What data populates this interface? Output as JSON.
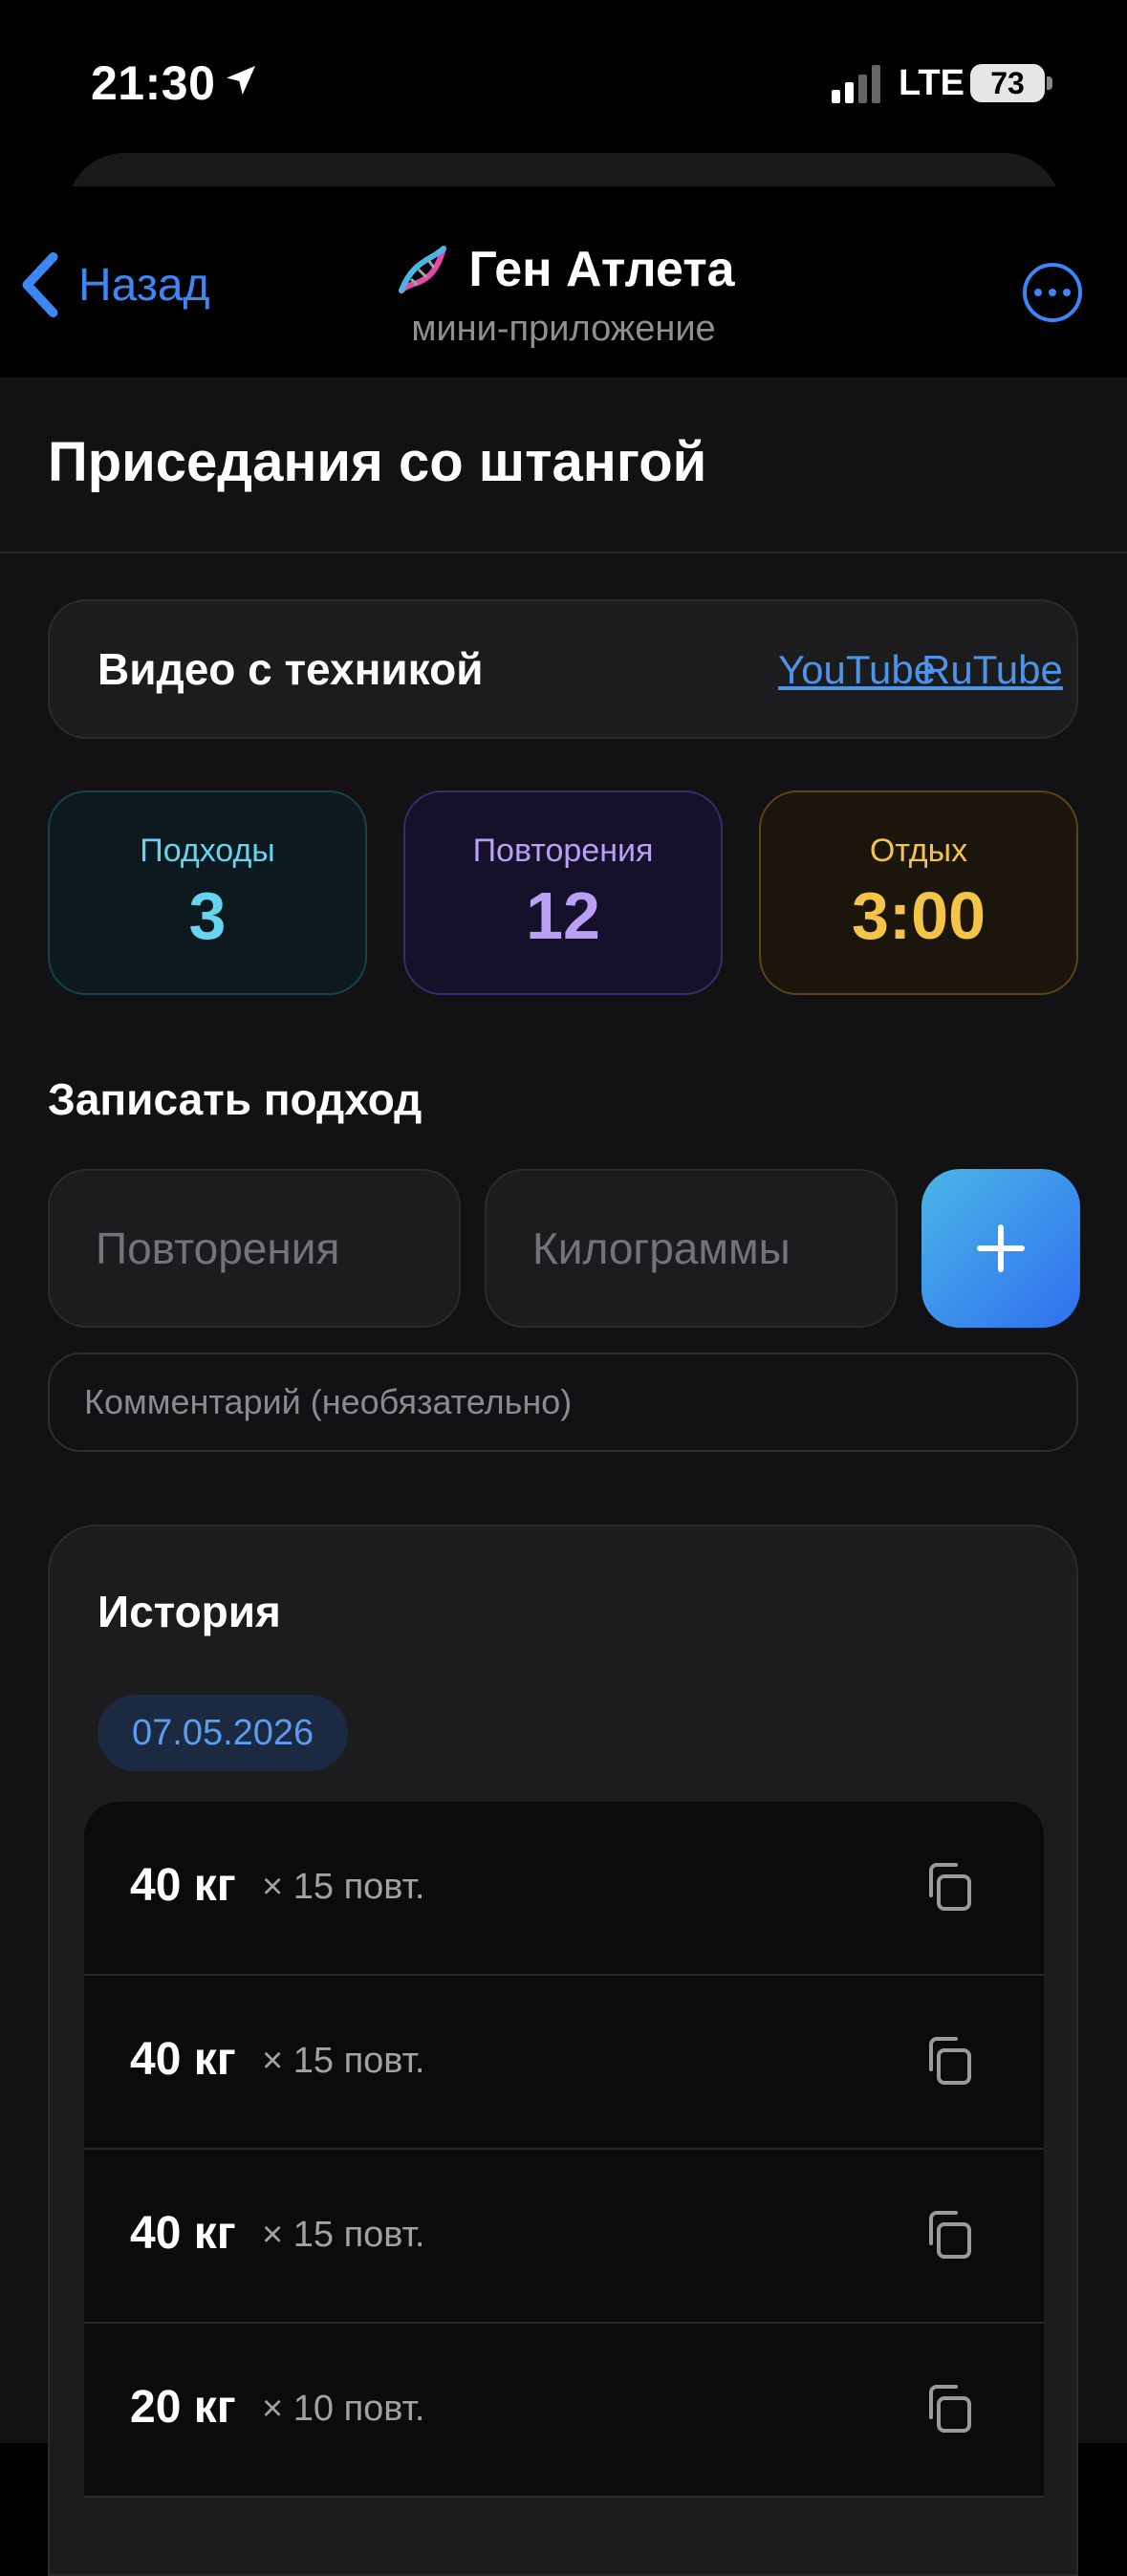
{
  "status_bar": {
    "time": "21:30",
    "network": "LTE",
    "battery": "73"
  },
  "nav": {
    "back_label": "Назад",
    "title": "Ген Атлета",
    "subtitle": "мини-приложение"
  },
  "page": {
    "title": "Приседания со штангой"
  },
  "video": {
    "label": "Видео с техникой",
    "links": [
      "YouTube",
      "RuTube"
    ]
  },
  "stats": [
    {
      "label": "Подходы",
      "value": "3",
      "color": "#67d3ec"
    },
    {
      "label": "Повторения",
      "value": "12",
      "color": "#b9a0f5"
    },
    {
      "label": "Отдых",
      "value": "3:00",
      "color": "#f4c447"
    }
  ],
  "log": {
    "title": "Записать подход",
    "reps_placeholder": "Повторения",
    "kg_placeholder": "Килограммы",
    "comment_placeholder": "Комментарий (необязательно)"
  },
  "history": {
    "title": "История",
    "date": "07.05.2026",
    "entries": [
      {
        "weight": "40 кг",
        "reps": "× 15 повт."
      },
      {
        "weight": "40 кг",
        "reps": "× 15 повт."
      },
      {
        "weight": "40 кг",
        "reps": "× 15 повт."
      },
      {
        "weight": "20 кг",
        "reps": "× 10 повт."
      }
    ]
  },
  "colors": {
    "accent": "#3d86f5",
    "link": "#4f93e6"
  }
}
